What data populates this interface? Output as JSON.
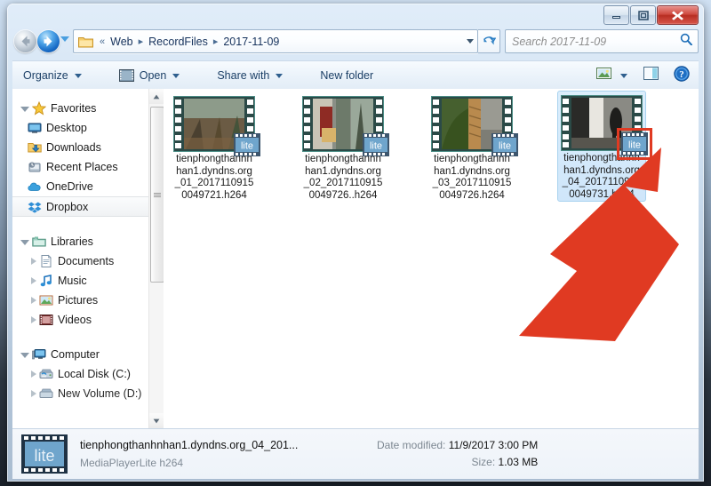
{
  "window": {
    "controls": {
      "minimize": "minimize-button",
      "maximize": "maximize-button",
      "close": "close-button"
    }
  },
  "address": {
    "back_tooltip": "Back",
    "forward_tooltip": "Forward",
    "crumbs": [
      "Web",
      "RecordFiles",
      "2017-11-09"
    ],
    "leading_separator": "«",
    "separator": "▸"
  },
  "search": {
    "placeholder": "Search 2017-11-09",
    "value": ""
  },
  "toolbar": {
    "organize": "Organize",
    "open": "Open",
    "share_with": "Share with",
    "new_folder": "New folder",
    "preview_pane_icon": "preview-pane-icon",
    "view_icon": "change-view-icon",
    "help_icon": "help-icon"
  },
  "navigation": {
    "groups": [
      {
        "label": "Favorites",
        "icon": "star-icon",
        "expanded": true,
        "items": [
          {
            "label": "Desktop",
            "icon": "desktop-icon",
            "selected": false
          },
          {
            "label": "Downloads",
            "icon": "downloads-icon",
            "selected": false
          },
          {
            "label": "Recent Places",
            "icon": "recent-places-icon",
            "selected": false
          },
          {
            "label": "OneDrive",
            "icon": "onedrive-icon",
            "selected": false
          },
          {
            "label": "Dropbox",
            "icon": "dropbox-icon",
            "selected": true
          }
        ]
      },
      {
        "label": "Libraries",
        "icon": "libraries-icon",
        "expanded": true,
        "items": [
          {
            "label": "Documents",
            "icon": "documents-icon",
            "selected": false
          },
          {
            "label": "Music",
            "icon": "music-icon",
            "selected": false
          },
          {
            "label": "Pictures",
            "icon": "pictures-icon",
            "selected": false
          },
          {
            "label": "Videos",
            "icon": "videos-icon",
            "selected": false
          }
        ]
      },
      {
        "label": "Computer",
        "icon": "computer-icon",
        "expanded": true,
        "items": [
          {
            "label": "Local Disk (C:)",
            "icon": "drive-icon",
            "selected": false
          },
          {
            "label": "New Volume (D:)",
            "icon": "drive-icon",
            "selected": false
          }
        ]
      }
    ]
  },
  "files": [
    {
      "name": "tienphongthanhnhan1.dyndns.org_01_20171109150049721.h264",
      "overlay_badge": "lite",
      "selected": false,
      "annotated": false
    },
    {
      "name": "tienphongthanhnhan1.dyndns.org_02_20171109150049726..h264",
      "overlay_badge": "lite",
      "selected": false,
      "annotated": false
    },
    {
      "name": "tienphongthanhnhan1.dyndns.org_03_20171109150049726.h264",
      "overlay_badge": "lite",
      "selected": false,
      "annotated": false
    },
    {
      "name": "tienphongthanhnhan1.dyndns.org_04_20171109150049731.h264",
      "overlay_badge": "lite",
      "selected": true,
      "annotated": true
    }
  ],
  "annotation": {
    "color": "#e03a22",
    "shape": "arrow-pointing-up-right",
    "highlight": "red-rectangle"
  },
  "details": {
    "icon": "mediaplayerlite-film-icon",
    "file_name": "tienphongthanhnhan1.dyndns.org_04_201...",
    "file_type": "MediaPlayerLite h264",
    "date_modified_label": "Date modified:",
    "date_modified_value": "11/9/2017 3:00 PM",
    "size_label": "Size:",
    "size_value": "1.03 MB"
  }
}
